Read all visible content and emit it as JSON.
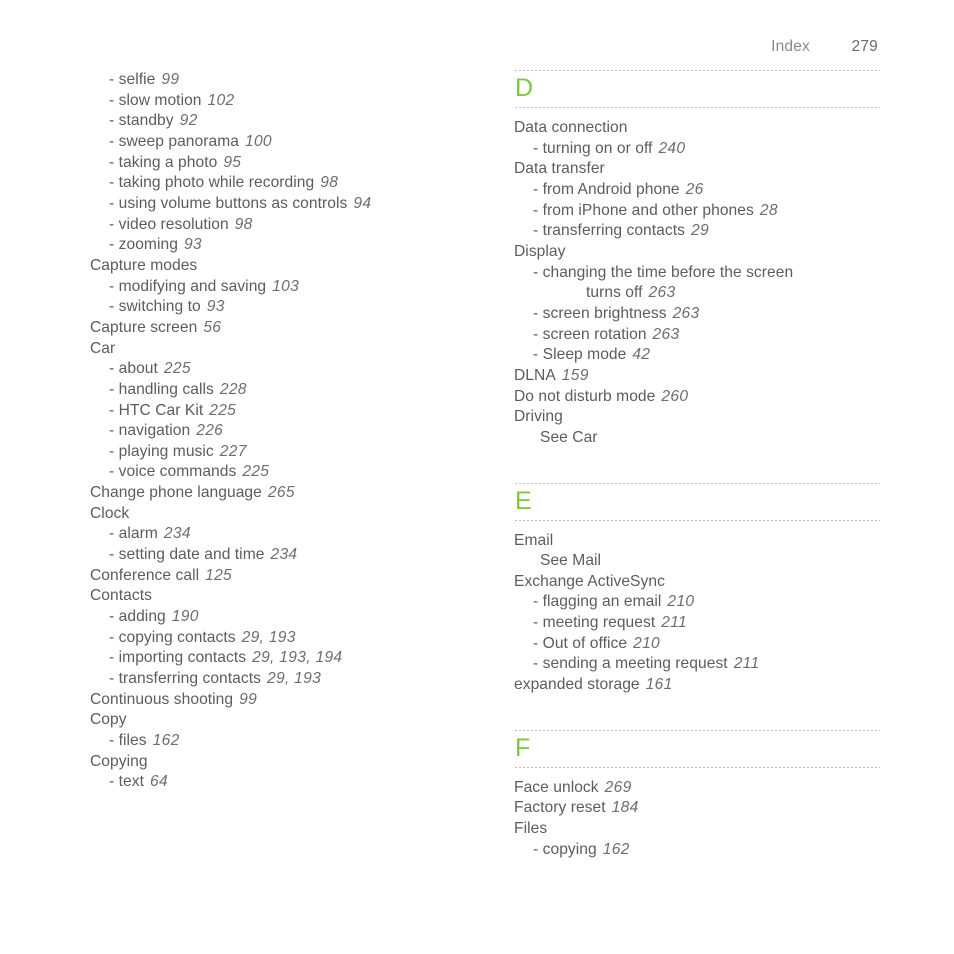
{
  "running_head": {
    "label": "Index",
    "page_number": "279"
  },
  "colors": {
    "letter_green": "#7cc83f",
    "body_text": "#5c5c5c",
    "page_number_text": "#6e6e6e",
    "rule_dots": "#7d7d7d",
    "background": "#ffffff"
  },
  "left_column": {
    "continued_entries": [
      {
        "level": "sub",
        "text": "selfie",
        "pages": "99"
      },
      {
        "level": "sub",
        "text": "slow motion",
        "pages": "102"
      },
      {
        "level": "sub",
        "text": "standby",
        "pages": "92"
      },
      {
        "level": "sub",
        "text": "sweep panorama",
        "pages": "100"
      },
      {
        "level": "sub",
        "text": "taking a photo",
        "pages": "95"
      },
      {
        "level": "sub",
        "text": "taking photo while recording",
        "pages": "98"
      },
      {
        "level": "sub",
        "text": "using volume buttons as controls",
        "pages": "94"
      },
      {
        "level": "sub",
        "text": "video resolution",
        "pages": "98"
      },
      {
        "level": "sub",
        "text": "zooming",
        "pages": "93"
      },
      {
        "level": "main",
        "text": "Capture modes",
        "pages": ""
      },
      {
        "level": "sub",
        "text": "modifying and saving",
        "pages": "103"
      },
      {
        "level": "sub",
        "text": "switching to",
        "pages": "93"
      },
      {
        "level": "main",
        "text": "Capture screen",
        "pages": "56"
      },
      {
        "level": "main",
        "text": "Car",
        "pages": ""
      },
      {
        "level": "sub",
        "text": "about",
        "pages": "225"
      },
      {
        "level": "sub",
        "text": "handling calls",
        "pages": "228"
      },
      {
        "level": "sub",
        "text": "HTC Car Kit",
        "pages": "225"
      },
      {
        "level": "sub",
        "text": "navigation",
        "pages": "226"
      },
      {
        "level": "sub",
        "text": "playing music",
        "pages": "227"
      },
      {
        "level": "sub",
        "text": "voice commands",
        "pages": "225"
      },
      {
        "level": "main",
        "text": "Change phone language",
        "pages": "265"
      },
      {
        "level": "main",
        "text": "Clock",
        "pages": ""
      },
      {
        "level": "sub",
        "text": "alarm",
        "pages": "234"
      },
      {
        "level": "sub",
        "text": "setting date and time",
        "pages": "234"
      },
      {
        "level": "main",
        "text": "Conference call",
        "pages": "125"
      },
      {
        "level": "main",
        "text": "Contacts",
        "pages": ""
      },
      {
        "level": "sub",
        "text": "adding",
        "pages": "190"
      },
      {
        "level": "sub",
        "text": "copying contacts",
        "pages": "29, 193"
      },
      {
        "level": "sub",
        "text": "importing contacts",
        "pages": "29, 193, 194"
      },
      {
        "level": "sub",
        "text": "transferring contacts",
        "pages": "29, 193"
      },
      {
        "level": "main",
        "text": "Continuous shooting",
        "pages": "99"
      },
      {
        "level": "main",
        "text": "Copy",
        "pages": ""
      },
      {
        "level": "sub",
        "text": "files",
        "pages": "162"
      },
      {
        "level": "main",
        "text": "Copying",
        "pages": ""
      },
      {
        "level": "sub",
        "text": "text",
        "pages": "64"
      }
    ]
  },
  "right_column": {
    "sections": [
      {
        "letter": "D",
        "entries": [
          {
            "level": "main",
            "text": "Data connection",
            "pages": ""
          },
          {
            "level": "sub",
            "text": "turning on or off",
            "pages": "240"
          },
          {
            "level": "main",
            "text": "Data transfer",
            "pages": ""
          },
          {
            "level": "sub",
            "text": "from Android phone",
            "pages": "26"
          },
          {
            "level": "sub",
            "text": "from iPhone and other phones",
            "pages": "28"
          },
          {
            "level": "sub",
            "text": "transferring contacts",
            "pages": "29"
          },
          {
            "level": "main",
            "text": "Display",
            "pages": ""
          },
          {
            "level": "sub",
            "text": "changing the time before the screen",
            "pages": ""
          },
          {
            "level": "cont",
            "text": "turns off",
            "pages": "263"
          },
          {
            "level": "sub",
            "text": "screen brightness",
            "pages": "263"
          },
          {
            "level": "sub",
            "text": "screen rotation",
            "pages": "263"
          },
          {
            "level": "sub",
            "text": "Sleep mode",
            "pages": "42"
          },
          {
            "level": "main",
            "text": "DLNA",
            "pages": "159"
          },
          {
            "level": "main",
            "text": "Do not disturb mode",
            "pages": "260"
          },
          {
            "level": "main",
            "text": "Driving",
            "pages": ""
          },
          {
            "level": "see",
            "text": "See Car",
            "pages": ""
          }
        ]
      },
      {
        "letter": "E",
        "entries": [
          {
            "level": "main",
            "text": "Email",
            "pages": ""
          },
          {
            "level": "see",
            "text": "See Mail",
            "pages": ""
          },
          {
            "level": "main",
            "text": "Exchange ActiveSync",
            "pages": ""
          },
          {
            "level": "sub",
            "text": "flagging an email",
            "pages": "210"
          },
          {
            "level": "sub",
            "text": "meeting request",
            "pages": "211"
          },
          {
            "level": "sub",
            "text": "Out of office",
            "pages": "210"
          },
          {
            "level": "sub",
            "text": "sending a meeting request",
            "pages": "211"
          },
          {
            "level": "main",
            "text": "expanded storage",
            "pages": "161"
          }
        ]
      },
      {
        "letter": "F",
        "entries": [
          {
            "level": "main",
            "text": "Face unlock",
            "pages": "269"
          },
          {
            "level": "main",
            "text": "Factory reset",
            "pages": "184"
          },
          {
            "level": "main",
            "text": "Files",
            "pages": ""
          },
          {
            "level": "sub",
            "text": "copying",
            "pages": "162"
          }
        ]
      }
    ]
  }
}
